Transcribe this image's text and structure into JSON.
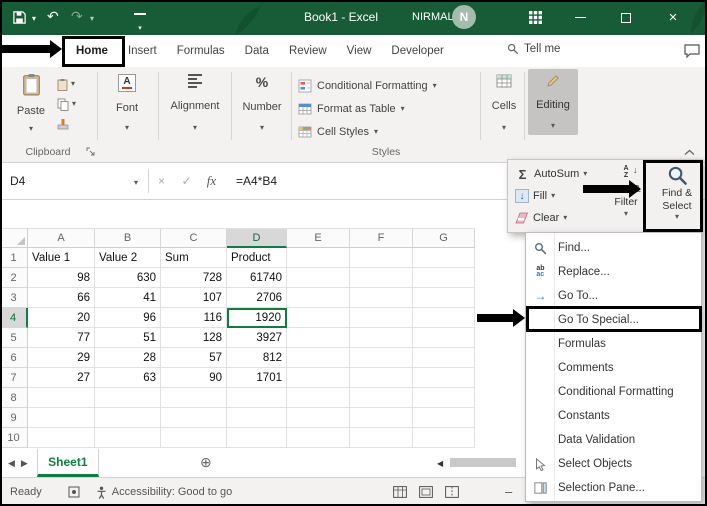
{
  "titlebar": {
    "title": "Book1 - Excel",
    "user_name": "NIRMAL",
    "avatar_initial": "N",
    "accent_color": "#185C37"
  },
  "ribbon_tabs": {
    "items": [
      "Home",
      "Insert",
      "Formulas",
      "Data",
      "Review",
      "View",
      "Developer"
    ],
    "active": "Home",
    "tell_me": "Tell me"
  },
  "ribbon": {
    "paste_label": "Paste",
    "font_label": "Font",
    "alignment_label": "Alignment",
    "number_label": "Number",
    "styles_buttons": [
      "Conditional Formatting",
      "Format as Table",
      "Cell Styles"
    ],
    "cells_label": "Cells",
    "editing_label": "Editing",
    "clipboard_group_label": "Clipboard",
    "styles_group_label": "Styles"
  },
  "editing_panel": {
    "autosum_label": "AutoSum",
    "fill_label": "Fill",
    "clear_label": "Clear",
    "sort_filter_label": "Sort & Filter",
    "find_select_label": "Find & Select"
  },
  "find_select_menu": {
    "items": [
      {
        "label": "Find...",
        "icon": "find-icon"
      },
      {
        "label": "Replace...",
        "icon": "replace-icon"
      },
      {
        "label": "Go To...",
        "icon": "goto-icon"
      },
      {
        "label": "Go To Special...",
        "icon": null,
        "annotated": true
      },
      {
        "label": "Formulas",
        "icon": null
      },
      {
        "label": "Comments",
        "icon": null
      },
      {
        "label": "Conditional Formatting",
        "icon": null
      },
      {
        "label": "Constants",
        "icon": null
      },
      {
        "label": "Data Validation",
        "icon": null
      },
      {
        "label": "Select Objects",
        "icon": "select-objects-icon"
      },
      {
        "label": "Selection Pane...",
        "icon": "selection-pane-icon"
      }
    ]
  },
  "formula_bar": {
    "name_box_value": "D4",
    "fx_label": "fx",
    "formula_value": "=A4*B4"
  },
  "grid": {
    "column_headers": [
      "A",
      "B",
      "C",
      "D",
      "E",
      "F",
      "G"
    ],
    "row_headers": [
      "1",
      "2",
      "3",
      "4",
      "5",
      "6",
      "7",
      "8",
      "9",
      "10"
    ],
    "cells": [
      [
        "Value 1",
        "Value 2",
        "Sum",
        "Product",
        "",
        "",
        ""
      ],
      [
        "98",
        "630",
        "728",
        "61740",
        "",
        "",
        ""
      ],
      [
        "66",
        "41",
        "107",
        "2706",
        "",
        "",
        ""
      ],
      [
        "20",
        "96",
        "116",
        "1920",
        "",
        "",
        ""
      ],
      [
        "77",
        "51",
        "128",
        "3927",
        "",
        "",
        ""
      ],
      [
        "29",
        "28",
        "57",
        "812",
        "",
        "",
        ""
      ],
      [
        "27",
        "63",
        "90",
        "1701",
        "",
        "",
        ""
      ],
      [
        "",
        "",
        "",
        "",
        "",
        "",
        ""
      ],
      [
        "",
        "",
        "",
        "",
        "",
        "",
        ""
      ],
      [
        "",
        "",
        "",
        "",
        "",
        "",
        ""
      ]
    ],
    "selected_column": "D",
    "selected_row": "4"
  },
  "sheet_bar": {
    "sheet_name": "Sheet1"
  },
  "status_bar": {
    "mode": "Ready",
    "accessibility": "Accessibility: Good to go"
  }
}
